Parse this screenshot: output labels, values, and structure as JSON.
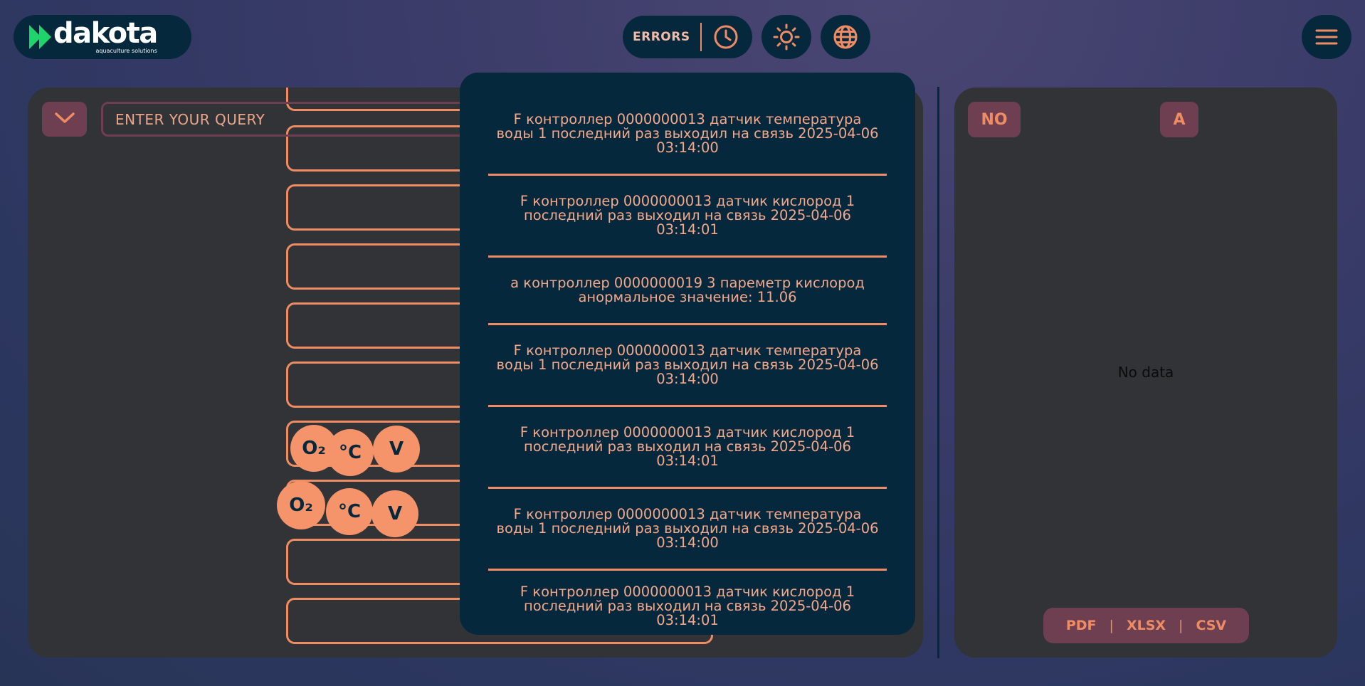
{
  "header": {
    "logo": {
      "word": "dakota",
      "subtitle": "aquaculture solutions"
    },
    "errors_label": "ERRORS",
    "icons": {
      "history": "clock-icon",
      "theme": "sun-icon",
      "language": "globe-icon",
      "menu": "hamburger-icon"
    }
  },
  "query": {
    "placeholder": "ENTER YOUR QUERY"
  },
  "sensor_bubbles": [
    "O₂",
    "°C",
    "V"
  ],
  "errors": [
    "F контроллер 0000000013 датчик температура воды 1 последний раз выходил на связь 2025-04-06 03:14:00",
    "F контроллер 0000000013 датчик кислород 1 последний раз выходил на связь 2025-04-06 03:14:01",
    "а контроллер 0000000019 3 пареметр кислород анормальное значение: 11.06",
    "F контроллер 0000000013 датчик температура воды 1 последний раз выходил на связь 2025-04-06 03:14:00",
    "F контроллер 0000000013 датчик кислород 1 последний раз выходил на связь 2025-04-06 03:14:01",
    "F контроллер 0000000013 датчик температура воды 1 последний раз выходил на связь 2025-04-06 03:14:00",
    "F контроллер 0000000013 датчик кислород 1 последний раз выходил на связь 2025-04-06 03:14:01"
  ],
  "right_panel": {
    "tag_no": "NO",
    "tag_a": "A",
    "empty_text": "No data",
    "export": {
      "pdf": "PDF",
      "xlsx": "XLSX",
      "csv": "CSV",
      "separator": "|"
    }
  },
  "colors": {
    "accent": "#f08c64",
    "navy": "#06283d",
    "panel": "#313336",
    "tag": "#6d3f50",
    "logo_green": "#1fd56b"
  }
}
